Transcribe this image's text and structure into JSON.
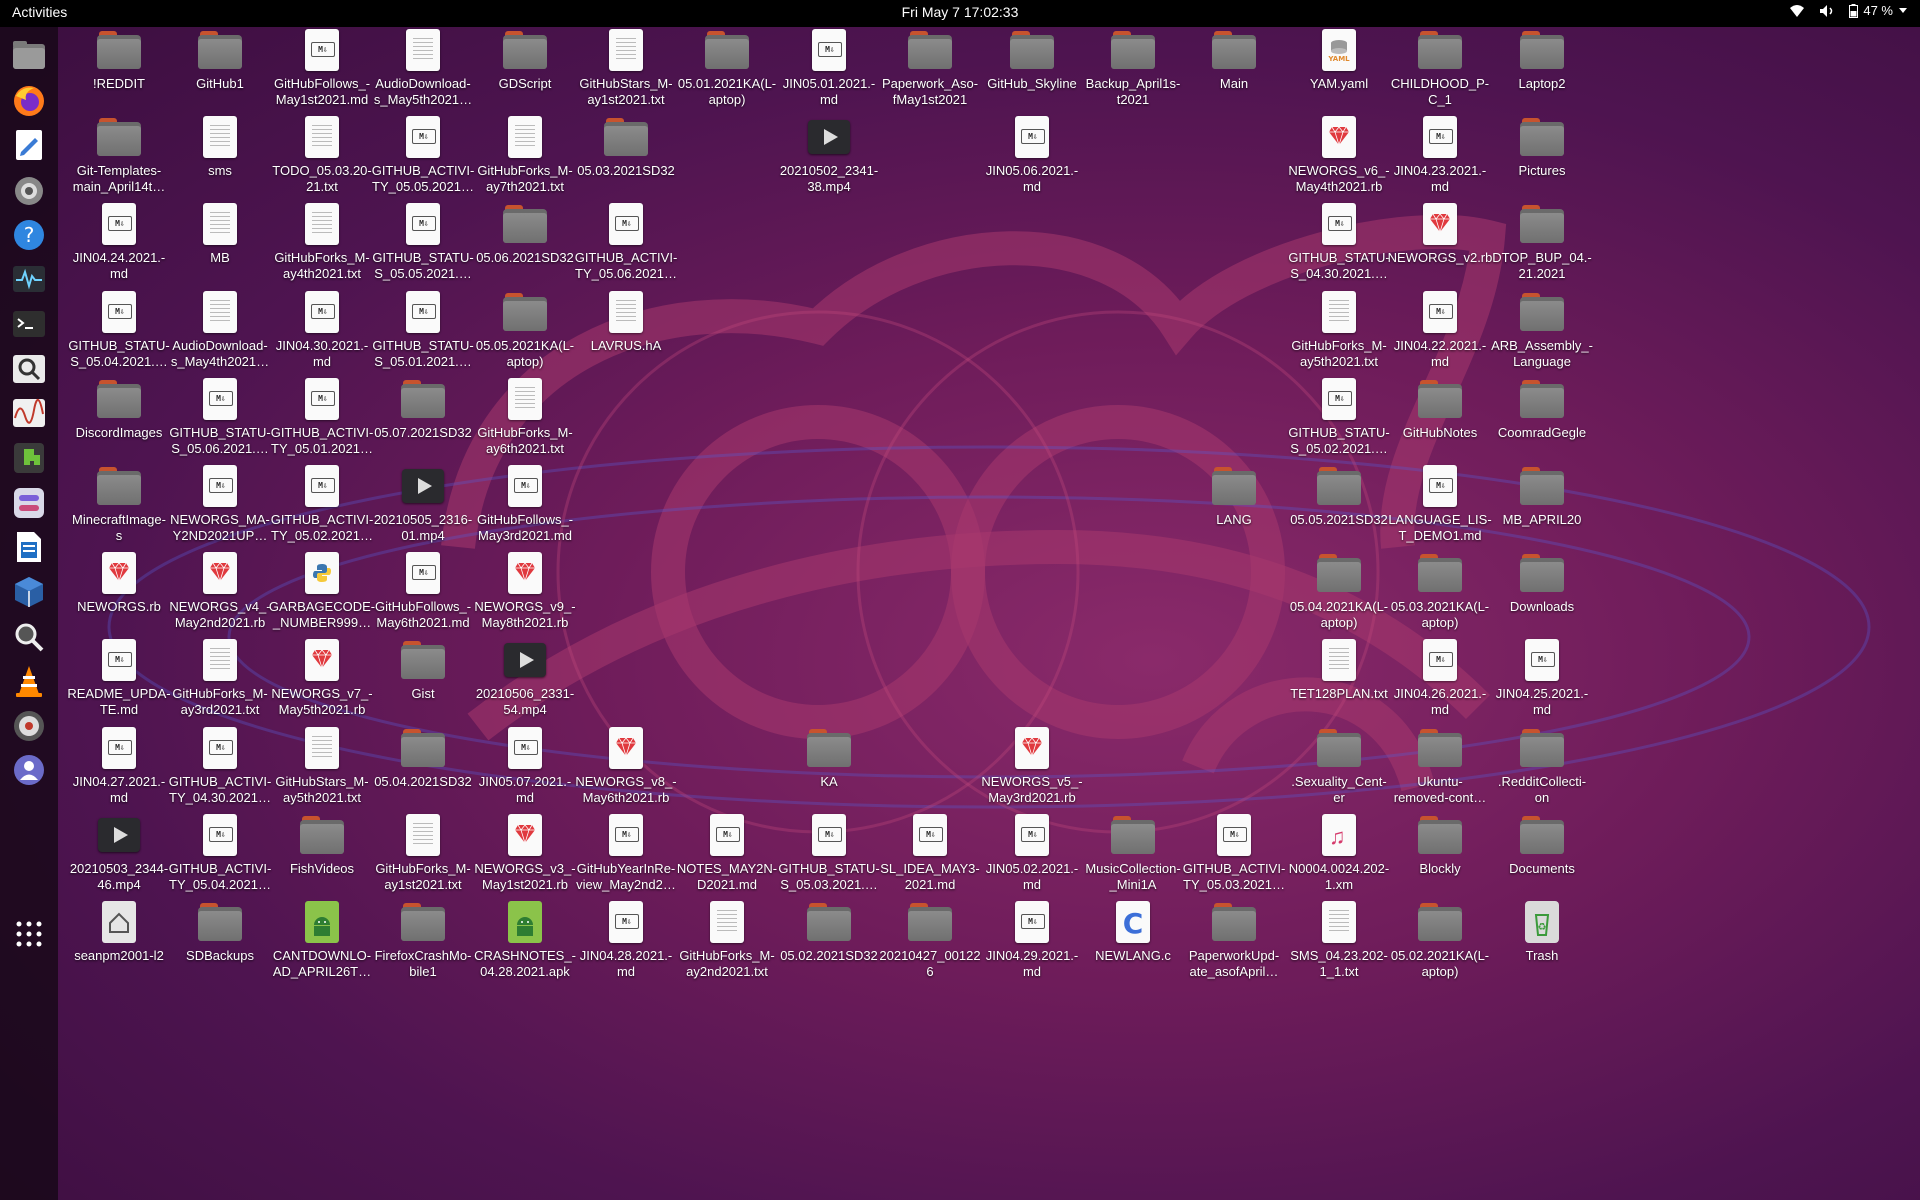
{
  "topbar": {
    "activities": "Activities",
    "clock": "Fri May 7  17:02:33",
    "battery": "47 %"
  },
  "dock": [
    {
      "name": "files-icon"
    },
    {
      "name": "firefox-icon"
    },
    {
      "name": "text-editor-icon"
    },
    {
      "name": "settings-icon"
    },
    {
      "name": "help-icon"
    },
    {
      "name": "system-monitor-icon"
    },
    {
      "name": "terminal-icon"
    },
    {
      "name": "search-tool-icon"
    },
    {
      "name": "sound-graph-icon"
    },
    {
      "name": "extensions-icon"
    },
    {
      "name": "tweaks-icon"
    },
    {
      "name": "writer-icon"
    },
    {
      "name": "virtualbox-icon"
    },
    {
      "name": "magnifier-icon"
    },
    {
      "name": "vlc-icon"
    },
    {
      "name": "disk-icon"
    },
    {
      "name": "user-tool-icon"
    },
    {
      "name": "show-apps-icon"
    }
  ],
  "desktop": [
    {
      "c": 0,
      "r": 0,
      "t": "folder",
      "label": "!REDDIT"
    },
    {
      "c": 1,
      "r": 0,
      "t": "folder",
      "label": "GitHub1"
    },
    {
      "c": 2,
      "r": 0,
      "t": "md",
      "label": "GitHubFollows_-\nMay1st2021.md"
    },
    {
      "c": 3,
      "r": 0,
      "t": "txt",
      "label": "AudioDownload-\ns_May5th2021…"
    },
    {
      "c": 4,
      "r": 0,
      "t": "folder",
      "label": "GDScript"
    },
    {
      "c": 5,
      "r": 0,
      "t": "txt",
      "label": "GitHubStars_M-\nay1st2021.txt"
    },
    {
      "c": 6,
      "r": 0,
      "t": "folder",
      "label": "05.01.2021KA(L-\naptop)"
    },
    {
      "c": 7,
      "r": 0,
      "t": "md",
      "label": "JIN05.01.2021.-\nmd"
    },
    {
      "c": 8,
      "r": 0,
      "t": "folder",
      "label": "Paperwork_Aso-\nfMay1st2021"
    },
    {
      "c": 9,
      "r": 0,
      "t": "folder",
      "label": "GitHub_Skyline"
    },
    {
      "c": 10,
      "r": 0,
      "t": "folder",
      "label": "Backup_April1s-\nt2021"
    },
    {
      "c": 11,
      "r": 0,
      "t": "folder",
      "label": "Main"
    },
    {
      "c": 12,
      "r": 0,
      "t": "yaml",
      "label": "YAM.yaml"
    },
    {
      "c": 13,
      "r": 0,
      "t": "folder",
      "label": "CHILDHOOD_P-\nC_1"
    },
    {
      "c": 14,
      "r": 0,
      "t": "folder",
      "label": "Laptop2"
    },
    {
      "c": 0,
      "r": 1,
      "t": "folder",
      "label": "Git-Templates-\nmain_April14t…"
    },
    {
      "c": 1,
      "r": 1,
      "t": "txt",
      "label": "sms"
    },
    {
      "c": 2,
      "r": 1,
      "t": "txt",
      "label": "TODO_05.03.20-\n21.txt"
    },
    {
      "c": 3,
      "r": 1,
      "t": "md",
      "label": "GITHUB_ACTIVI-\nTY_05.05.2021…"
    },
    {
      "c": 4,
      "r": 1,
      "t": "txt",
      "label": "GitHubForks_M-\nay7th2021.txt"
    },
    {
      "c": 5,
      "r": 1,
      "t": "folder",
      "label": "05.03.2021SD32"
    },
    {
      "c": 7,
      "r": 1,
      "t": "video",
      "label": "20210502_2341-\n38.mp4"
    },
    {
      "c": 9,
      "r": 1,
      "t": "md",
      "label": "JIN05.06.2021.-\nmd"
    },
    {
      "c": 12,
      "r": 1,
      "t": "ruby",
      "label": "NEWORGS_v6_-\nMay4th2021.rb"
    },
    {
      "c": 13,
      "r": 1,
      "t": "md",
      "label": "JIN04.23.2021.-\nmd"
    },
    {
      "c": 14,
      "r": 1,
      "t": "folder",
      "label": "Pictures"
    },
    {
      "c": 0,
      "r": 2,
      "t": "md",
      "label": "JIN04.24.2021.-\nmd"
    },
    {
      "c": 1,
      "r": 2,
      "t": "txt",
      "label": "MB"
    },
    {
      "c": 2,
      "r": 2,
      "t": "txt",
      "label": "GitHubForks_M-\nay4th2021.txt"
    },
    {
      "c": 3,
      "r": 2,
      "t": "md",
      "label": "GITHUB_STATU-\nS_05.05.2021.…"
    },
    {
      "c": 4,
      "r": 2,
      "t": "folder",
      "label": "05.06.2021SD32"
    },
    {
      "c": 5,
      "r": 2,
      "t": "md",
      "label": "GITHUB_ACTIVI-\nTY_05.06.2021…"
    },
    {
      "c": 12,
      "r": 2,
      "t": "md",
      "label": "GITHUB_STATU-\nS_04.30.2021.…"
    },
    {
      "c": 13,
      "r": 2,
      "t": "ruby",
      "label": "NEWORGS_v2.rb"
    },
    {
      "c": 14,
      "r": 2,
      "t": "folder",
      "label": "DTOP_BUP_04.-\n21.2021"
    },
    {
      "c": 0,
      "r": 3,
      "t": "md",
      "label": "GITHUB_STATU-\nS_05.04.2021.…"
    },
    {
      "c": 1,
      "r": 3,
      "t": "txt",
      "label": "AudioDownload-\ns_May4th2021…"
    },
    {
      "c": 2,
      "r": 3,
      "t": "md",
      "label": "JIN04.30.2021.-\nmd"
    },
    {
      "c": 3,
      "r": 3,
      "t": "md",
      "label": "GITHUB_STATU-\nS_05.01.2021.…"
    },
    {
      "c": 4,
      "r": 3,
      "t": "folder",
      "label": "05.05.2021KA(L-\naptop)"
    },
    {
      "c": 5,
      "r": 3,
      "t": "txt",
      "label": "LAVRUS.hA"
    },
    {
      "c": 12,
      "r": 3,
      "t": "txt",
      "label": "GitHubForks_M-\nay5th2021.txt"
    },
    {
      "c": 13,
      "r": 3,
      "t": "md",
      "label": "JIN04.22.2021.-\nmd"
    },
    {
      "c": 14,
      "r": 3,
      "t": "folder",
      "label": "ARB_Assembly_-\nLanguage"
    },
    {
      "c": 0,
      "r": 4,
      "t": "folder",
      "label": "DiscordImages"
    },
    {
      "c": 1,
      "r": 4,
      "t": "md",
      "label": "GITHUB_STATU-\nS_05.06.2021.…"
    },
    {
      "c": 2,
      "r": 4,
      "t": "md",
      "label": "GITHUB_ACTIVI-\nTY_05.01.2021…"
    },
    {
      "c": 3,
      "r": 4,
      "t": "folder",
      "label": "05.07.2021SD32"
    },
    {
      "c": 4,
      "r": 4,
      "t": "txt",
      "label": "GitHubForks_M-\nay6th2021.txt"
    },
    {
      "c": 12,
      "r": 4,
      "t": "md",
      "label": "GITHUB_STATU-\nS_05.02.2021.…"
    },
    {
      "c": 13,
      "r": 4,
      "t": "folder",
      "label": "GitHubNotes"
    },
    {
      "c": 14,
      "r": 4,
      "t": "folder",
      "label": "CoomradGegle"
    },
    {
      "c": 0,
      "r": 5,
      "t": "folder",
      "label": "MinecraftImage-\ns"
    },
    {
      "c": 1,
      "r": 5,
      "t": "md",
      "label": "NEWORGS_MA-\nY2ND2021UP…"
    },
    {
      "c": 2,
      "r": 5,
      "t": "md",
      "label": "GITHUB_ACTIVI-\nTY_05.02.2021…"
    },
    {
      "c": 3,
      "r": 5,
      "t": "video",
      "label": "20210505_2316-\n01.mp4"
    },
    {
      "c": 4,
      "r": 5,
      "t": "md",
      "label": "GitHubFollows_-\nMay3rd2021.md"
    },
    {
      "c": 11,
      "r": 5,
      "t": "folder",
      "label": "LANG"
    },
    {
      "c": 12,
      "r": 5,
      "t": "folder",
      "label": "05.05.2021SD32"
    },
    {
      "c": 13,
      "r": 5,
      "t": "md",
      "label": "LANGUAGE_LIS-\nT_DEMO1.md"
    },
    {
      "c": 14,
      "r": 5,
      "t": "folder",
      "label": "MB_APRIL20"
    },
    {
      "c": 0,
      "r": 6,
      "t": "ruby",
      "label": "NEWORGS.rb"
    },
    {
      "c": 1,
      "r": 6,
      "t": "ruby",
      "label": "NEWORGS_v4_-\nMay2nd2021.rb"
    },
    {
      "c": 2,
      "r": 6,
      "t": "py",
      "label": "GARBAGECODE-\n_NUMBER999…"
    },
    {
      "c": 3,
      "r": 6,
      "t": "md",
      "label": "GitHubFollows_-\nMay6th2021.md"
    },
    {
      "c": 4,
      "r": 6,
      "t": "ruby",
      "label": "NEWORGS_v9_-\nMay8th2021.rb"
    },
    {
      "c": 12,
      "r": 6,
      "t": "folder",
      "label": "05.04.2021KA(L-\naptop)"
    },
    {
      "c": 13,
      "r": 6,
      "t": "folder",
      "label": "05.03.2021KA(L-\naptop)"
    },
    {
      "c": 14,
      "r": 6,
      "t": "folder",
      "label": "Downloads"
    },
    {
      "c": 0,
      "r": 7,
      "t": "md",
      "label": "README_UPDA-\nTE.md"
    },
    {
      "c": 1,
      "r": 7,
      "t": "txt",
      "label": "GitHubForks_M-\nay3rd2021.txt"
    },
    {
      "c": 2,
      "r": 7,
      "t": "ruby",
      "label": "NEWORGS_v7_-\nMay5th2021.rb"
    },
    {
      "c": 3,
      "r": 7,
      "t": "folder",
      "label": "Gist"
    },
    {
      "c": 4,
      "r": 7,
      "t": "video",
      "label": "20210506_2331-\n54.mp4"
    },
    {
      "c": 12,
      "r": 7,
      "t": "txt",
      "label": "TET128PLAN.txt"
    },
    {
      "c": 13,
      "r": 7,
      "t": "md",
      "label": "JIN04.26.2021.-\nmd"
    },
    {
      "c": 14,
      "r": 7,
      "t": "md",
      "label": "JIN04.25.2021.-\nmd"
    },
    {
      "c": 0,
      "r": 8,
      "t": "md",
      "label": "JIN04.27.2021.-\nmd"
    },
    {
      "c": 1,
      "r": 8,
      "t": "md",
      "label": "GITHUB_ACTIVI-\nTY_04.30.2021…"
    },
    {
      "c": 2,
      "r": 8,
      "t": "txt",
      "label": "GitHubStars_M-\nay5th2021.txt"
    },
    {
      "c": 3,
      "r": 8,
      "t": "folder",
      "label": "05.04.2021SD32"
    },
    {
      "c": 4,
      "r": 8,
      "t": "md",
      "label": "JIN05.07.2021.-\nmd"
    },
    {
      "c": 5,
      "r": 8,
      "t": "ruby",
      "label": "NEWORGS_v8_-\nMay6th2021.rb"
    },
    {
      "c": 7,
      "r": 8,
      "t": "folder",
      "label": "KA"
    },
    {
      "c": 9,
      "r": 8,
      "t": "ruby",
      "label": "NEWORGS_v5_-\nMay3rd2021.rb"
    },
    {
      "c": 12,
      "r": 8,
      "t": "folder",
      "label": ".Sexuality_Cent-\ner"
    },
    {
      "c": 13,
      "r": 8,
      "t": "folder",
      "label": "Ukuntu-\nremoved-cont…"
    },
    {
      "c": 14,
      "r": 8,
      "t": "folder",
      "label": ".RedditCollecti-\non"
    },
    {
      "c": 0,
      "r": 9,
      "t": "video",
      "label": "20210503_2344-\n46.mp4"
    },
    {
      "c": 1,
      "r": 9,
      "t": "md",
      "label": "GITHUB_ACTIVI-\nTY_05.04.2021…"
    },
    {
      "c": 2,
      "r": 9,
      "t": "folder",
      "label": "FishVideos"
    },
    {
      "c": 3,
      "r": 9,
      "t": "txt",
      "label": "GitHubForks_M-\nay1st2021.txt"
    },
    {
      "c": 4,
      "r": 9,
      "t": "ruby",
      "label": "NEWORGS_v3_-\nMay1st2021.rb"
    },
    {
      "c": 5,
      "r": 9,
      "t": "md",
      "label": "GitHubYearInRe-\nview_May2nd2…"
    },
    {
      "c": 6,
      "r": 9,
      "t": "md",
      "label": "NOTES_MAY2N-\nD2021.md"
    },
    {
      "c": 7,
      "r": 9,
      "t": "md",
      "label": "GITHUB_STATU-\nS_05.03.2021.…"
    },
    {
      "c": 8,
      "r": 9,
      "t": "md",
      "label": "SL_IDEA_MAY3-\n2021.md"
    },
    {
      "c": 9,
      "r": 9,
      "t": "md",
      "label": "JIN05.02.2021.-\nmd"
    },
    {
      "c": 10,
      "r": 9,
      "t": "folder",
      "label": "MusicCollection-\n_Mini1A"
    },
    {
      "c": 11,
      "r": 9,
      "t": "md",
      "label": "GITHUB_ACTIVI-\nTY_05.03.2021…"
    },
    {
      "c": 12,
      "r": 9,
      "t": "music",
      "label": "N0004.0024.202-\n1.xm"
    },
    {
      "c": 13,
      "r": 9,
      "t": "folder",
      "label": "Blockly"
    },
    {
      "c": 14,
      "r": 9,
      "t": "folder",
      "label": "Documents"
    },
    {
      "c": 0,
      "r": 10,
      "t": "home",
      "label": "seanpm2001-l2"
    },
    {
      "c": 1,
      "r": 10,
      "t": "folder",
      "label": "SDBackups"
    },
    {
      "c": 2,
      "r": 10,
      "t": "apk",
      "label": "CANTDOWNLO-\nAD_APRIL26T…"
    },
    {
      "c": 3,
      "r": 10,
      "t": "folder",
      "label": "FirefoxCrashMo-\nbile1"
    },
    {
      "c": 4,
      "r": 10,
      "t": "apk",
      "label": "CRASHNOTES_-\n04.28.2021.apk"
    },
    {
      "c": 5,
      "r": 10,
      "t": "md",
      "label": "JIN04.28.2021.-\nmd"
    },
    {
      "c": 6,
      "r": 10,
      "t": "txt",
      "label": "GitHubForks_M-\nay2nd2021.txt"
    },
    {
      "c": 7,
      "r": 10,
      "t": "folder",
      "label": "05.02.2021SD32"
    },
    {
      "c": 8,
      "r": 10,
      "t": "folder",
      "label": "20210427_00122\n6"
    },
    {
      "c": 9,
      "r": 10,
      "t": "md",
      "label": "JIN04.29.2021.-\nmd"
    },
    {
      "c": 10,
      "r": 10,
      "t": "c",
      "label": "NEWLANG.c"
    },
    {
      "c": 11,
      "r": 10,
      "t": "folder",
      "label": "PaperworkUpd-\nate_asofApril…"
    },
    {
      "c": 12,
      "r": 10,
      "t": "txt",
      "label": "SMS_04.23.202-\n1_1.txt"
    },
    {
      "c": 13,
      "r": 10,
      "t": "folder",
      "label": "05.02.2021KA(L-\naptop)"
    },
    {
      "c": 14,
      "r": 10,
      "t": "trash",
      "label": "Trash"
    }
  ]
}
